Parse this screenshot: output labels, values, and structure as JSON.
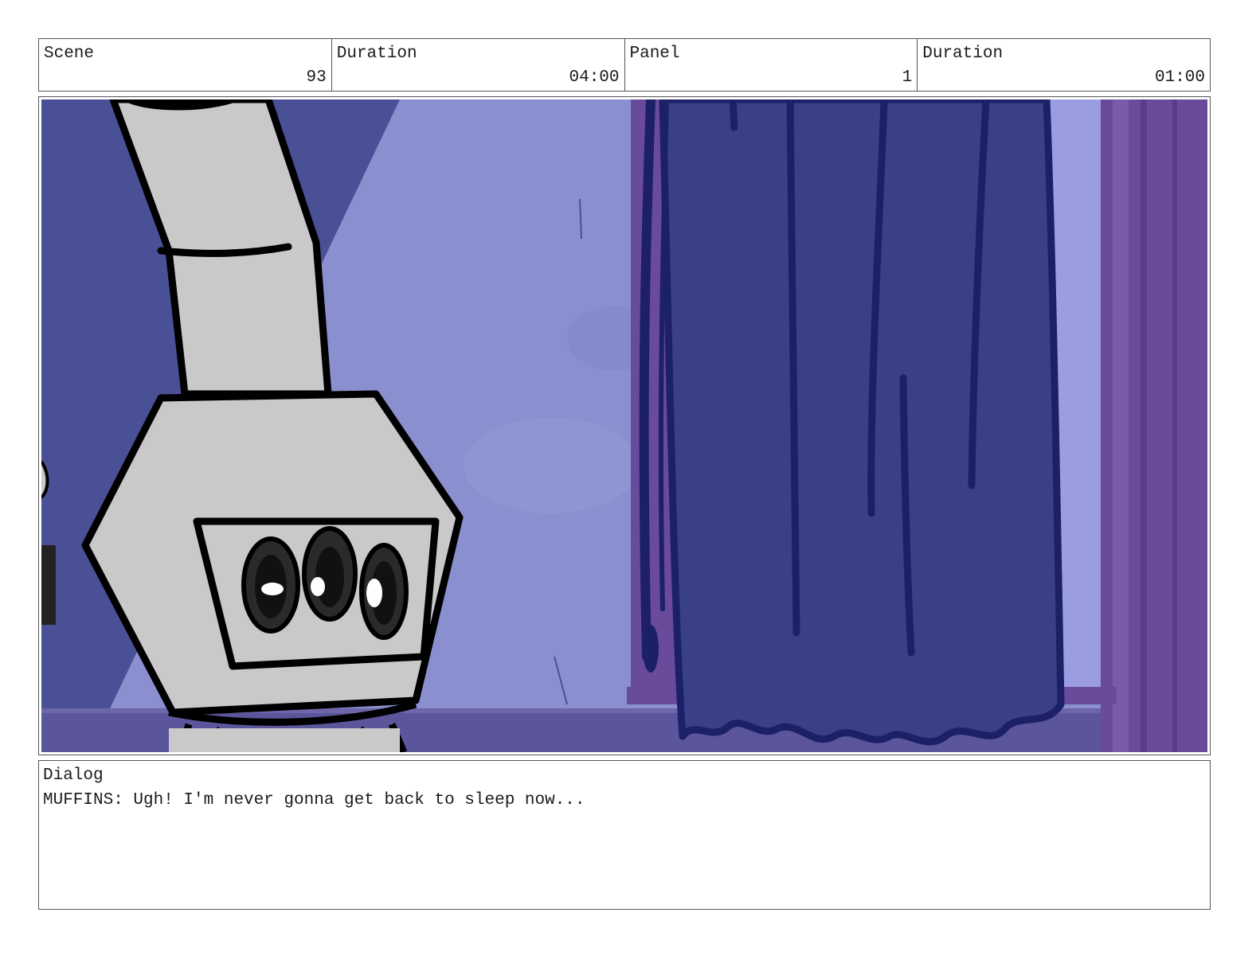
{
  "header": {
    "scene_label": "Scene",
    "scene_value": "93",
    "scene_duration_label": "Duration",
    "scene_duration_value": "04:00",
    "panel_label": "Panel",
    "panel_value": "1",
    "panel_duration_label": "Duration",
    "panel_duration_value": "01:00"
  },
  "dialog": {
    "label": "Dialog",
    "text": "MUFFINS: Ugh! I'm never gonna get back to sleep now..."
  },
  "colors": {
    "wall_light": "#8a8fcf",
    "wall_shadow": "#4a5096",
    "curtain": "#3a4088",
    "curtain_outline": "#1c2066",
    "window_frame": "#6a4a9a",
    "stove_body": "#c9c9c9",
    "outline": "#000000"
  },
  "panel_image": {
    "description_icon": "storyboard-panel-illustration"
  }
}
